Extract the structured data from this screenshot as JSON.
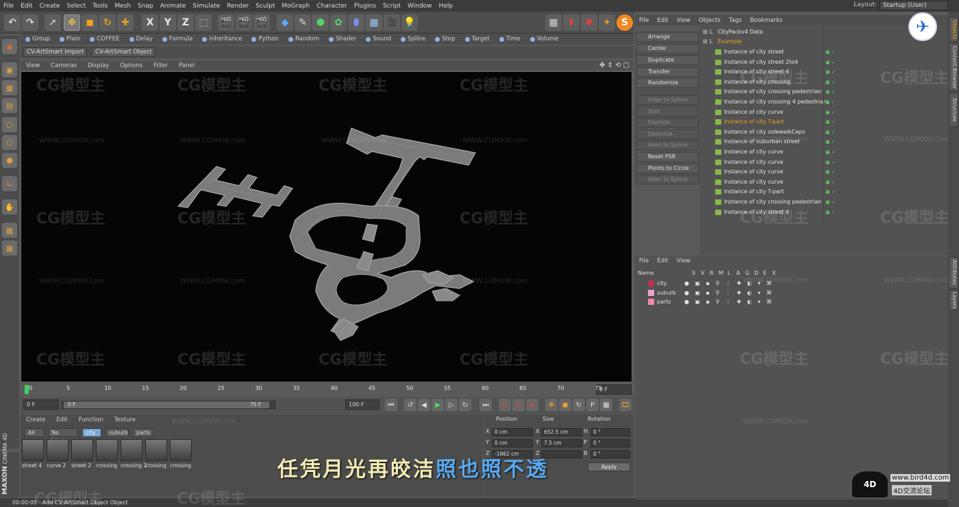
{
  "menubar": {
    "items": [
      "File",
      "Edit",
      "Create",
      "Select",
      "Tools",
      "Mesh",
      "Snap",
      "Animate",
      "Simulate",
      "Render",
      "Sculpt",
      "MoGraph",
      "Character",
      "Plugins",
      "Script",
      "Window",
      "Help"
    ],
    "layout_label": "Layout:",
    "layout_value": "Startup (User)"
  },
  "toolbar": {
    "axis_x": "X",
    "axis_y": "Y",
    "axis_z": "Z"
  },
  "subbar": [
    "Group",
    "Plain",
    "COFFEE",
    "Delay",
    "Formula",
    "Inheritance",
    "Python",
    "Random",
    "Shader",
    "Sound",
    "Spline",
    "Step",
    "Target",
    "Time",
    "Volume"
  ],
  "plugins": [
    "CV-ArtSmart Import",
    "CV-ArtSmart Object"
  ],
  "viewport_menu": [
    "View",
    "Cameras",
    "Display",
    "Options",
    "Filter",
    "Panel"
  ],
  "timeline": {
    "ticks": [
      "0",
      "5",
      "10",
      "15",
      "20",
      "25",
      "30",
      "35",
      "40",
      "45",
      "50",
      "55",
      "60",
      "65",
      "70",
      "75"
    ],
    "frame_right": "0 F"
  },
  "transport": {
    "start": "0 F",
    "range_start": "0 F",
    "range_end": "75 F",
    "end": "100 F"
  },
  "materials": {
    "menu": [
      "Create",
      "Edit",
      "Function",
      "Texture"
    ],
    "tabs": [
      "All",
      "No Layer",
      "city",
      "suburb",
      "parts"
    ],
    "items": [
      "street 4",
      "curve 2",
      "street 2",
      "crossing",
      "crossing 2",
      "crossing",
      "crossing"
    ]
  },
  "coords": {
    "headers": [
      "Position",
      "Size",
      "Rotation"
    ],
    "rows": [
      {
        "axis": "X",
        "pos": "0 cm",
        "size": "652.5 cm",
        "rlabel": "H",
        "rot": "0 °"
      },
      {
        "axis": "Y",
        "pos": "0 cm",
        "size": "7.5 cm",
        "rlabel": "P",
        "rot": "0 °"
      },
      {
        "axis": "Z",
        "pos": "-1862 cm",
        "size": "",
        "rlabel": "B",
        "rot": "0 °"
      }
    ],
    "apply": "Apply"
  },
  "commands": [
    {
      "label": "Arrange",
      "enabled": true
    },
    {
      "label": "Center",
      "enabled": true
    },
    {
      "label": "Duplicate",
      "enabled": true
    },
    {
      "label": "Transfer",
      "enabled": true
    },
    {
      "label": "Randomize",
      "enabled": true
    },
    {
      "label": "Edge to Spline",
      "enabled": false
    },
    {
      "label": "Split",
      "enabled": false
    },
    {
      "label": "Explode Segments",
      "enabled": false
    },
    {
      "label": "Optimize",
      "enabled": false
    },
    {
      "label": "Alien to Spline",
      "enabled": false
    },
    {
      "label": "Reset PSR",
      "enabled": true
    },
    {
      "label": "Points to Circle",
      "enabled": true
    },
    {
      "label": "Alien to Spline",
      "enabled": false
    }
  ],
  "object_manager": {
    "menu": [
      "File",
      "Edit",
      "View",
      "Objects",
      "Tags",
      "Bookmarks"
    ],
    "root": "CityPackv4 Data",
    "group": "Example",
    "objects": [
      "Instance of city street",
      "Instance of city street 2to4",
      "Instance of city street 4",
      "Instance of city crossing",
      "Instance of city crossing pedestrian",
      "Instance of city crossing 4 pedestrian",
      "Instance of city curve",
      "Instance of city T-part",
      "Instance of city sidewalkCaps",
      "Instance of suburban street",
      "Instance of city curve",
      "Instance of city curve",
      "Instance of city curve",
      "Instance of city curve",
      "Instance of city T-part",
      "Instance of city crossing pedestrian",
      "Instance of city street 4"
    ],
    "selected_index": 7
  },
  "layer_manager": {
    "menu": [
      "File",
      "Edit",
      "View"
    ],
    "columns": [
      "Name",
      "S",
      "V",
      "R",
      "M",
      "L",
      "A",
      "G",
      "D",
      "E",
      "X"
    ],
    "layers": [
      {
        "name": "city",
        "color": "#c03050"
      },
      {
        "name": "suburb",
        "color": "#f0a0c8"
      },
      {
        "name": "parts",
        "color": "#f08aa8"
      }
    ]
  },
  "right_tabs": [
    "Objects",
    "Content Browser",
    "Structure",
    "Attributes",
    "Layers"
  ],
  "status": {
    "time": "00:00:05",
    "message": "Add CV-ArtSmart Object Object"
  },
  "brand": {
    "maxon": "MAXON",
    "product": "CINEMA 4D"
  },
  "watermark": {
    "logo": "CG模型主",
    "url": "WWW.CGMXW.com"
  },
  "subtitle": {
    "part1": "任凭月光再皎洁",
    "part2": "照也照不透"
  },
  "badge": {
    "text": "www.bird4d.com",
    "sub": "4D交流论坛",
    "logo": "4D"
  },
  "colors": {
    "accent": "#f0a020",
    "selected_tab": "#7aa6d8"
  }
}
